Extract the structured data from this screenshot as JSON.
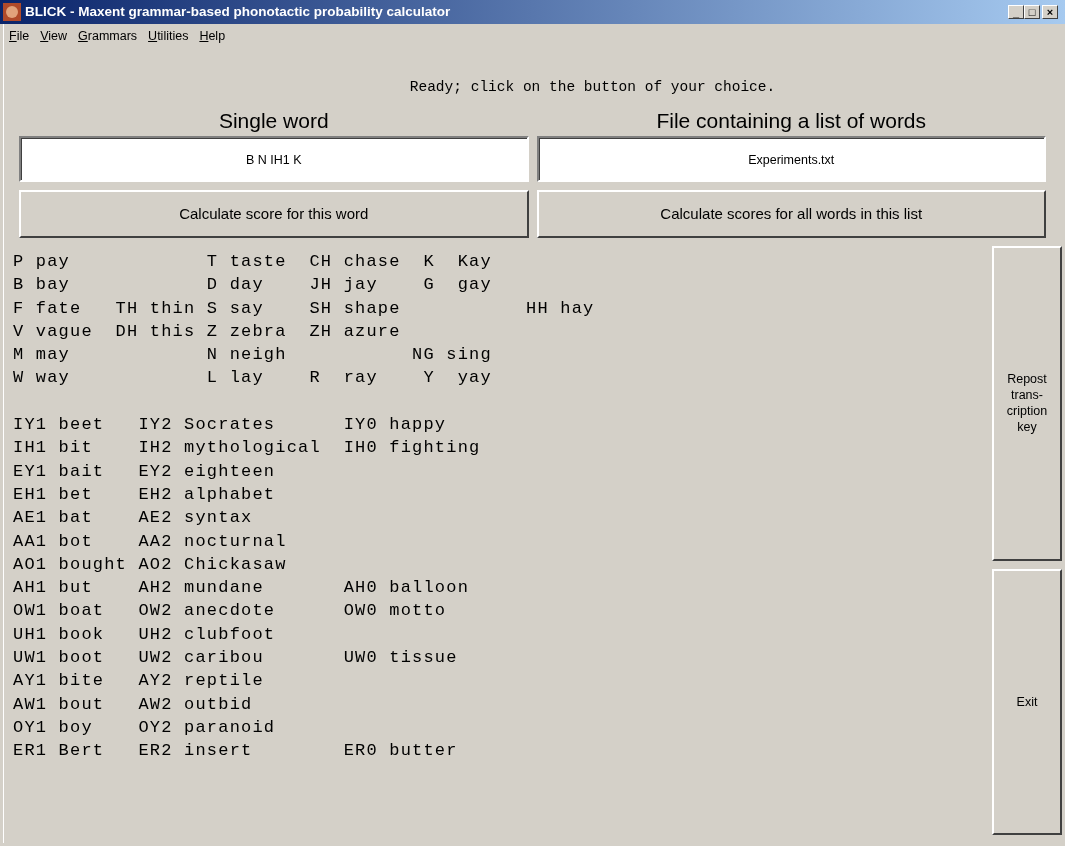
{
  "window": {
    "title": "BLICK - Maxent grammar-based phonotactic probability calculator",
    "controls": [
      "_",
      "□",
      "×"
    ]
  },
  "menu": [
    {
      "label": "File",
      "first_letter_underlined": true
    },
    {
      "label": "View",
      "first_letter_underlined": true
    },
    {
      "label": "Grammars",
      "first_letter_underlined": true
    },
    {
      "label": "Utilities",
      "first_letter_underlined": true
    },
    {
      "label": "Help",
      "first_letter_underlined": true
    }
  ],
  "status": "Ready; click on the button of your choice.",
  "single_word": {
    "heading": "Single word",
    "value": "B N IH1 K",
    "button": "Calculate score for this word"
  },
  "word_list": {
    "heading": "File containing a list of words",
    "value": "Experiments.txt",
    "button": "Calculate scores for all words in this list"
  },
  "consonant_key": [
    "P pay            T taste  CH chase  K  Kay",
    "B bay            D day    JH jay    G  gay",
    "F fate   TH thin S say    SH shape           HH hay",
    "V vague  DH this Z zebra  ZH azure",
    "M may            N neigh           NG sing",
    "W way            L lay    R  ray    Y  yay"
  ],
  "vowel_key": [
    "IY1 beet   IY2 Socrates      IY0 happy",
    "IH1 bit    IH2 mythological  IH0 fighting",
    "EY1 bait   EY2 eighteen",
    "EH1 bet    EH2 alphabet",
    "AE1 bat    AE2 syntax",
    "AA1 bot    AA2 nocturnal",
    "AO1 bought AO2 Chickasaw",
    "AH1 but    AH2 mundane       AH0 balloon",
    "OW1 boat   OW2 anecdote      OW0 motto",
    "UH1 book   UH2 clubfoot",
    "UW1 boot   UW2 caribou       UW0 tissue",
    "AY1 bite   AY2 reptile",
    "AW1 bout   AW2 outbid",
    "OY1 boy    OY2 paranoid",
    "ER1 Bert   ER2 insert        ER0 butter"
  ],
  "side_buttons": [
    {
      "lines": [
        "Repost",
        "trans-",
        "cription",
        "key"
      ]
    },
    {
      "lines": [
        "Exit"
      ]
    }
  ]
}
